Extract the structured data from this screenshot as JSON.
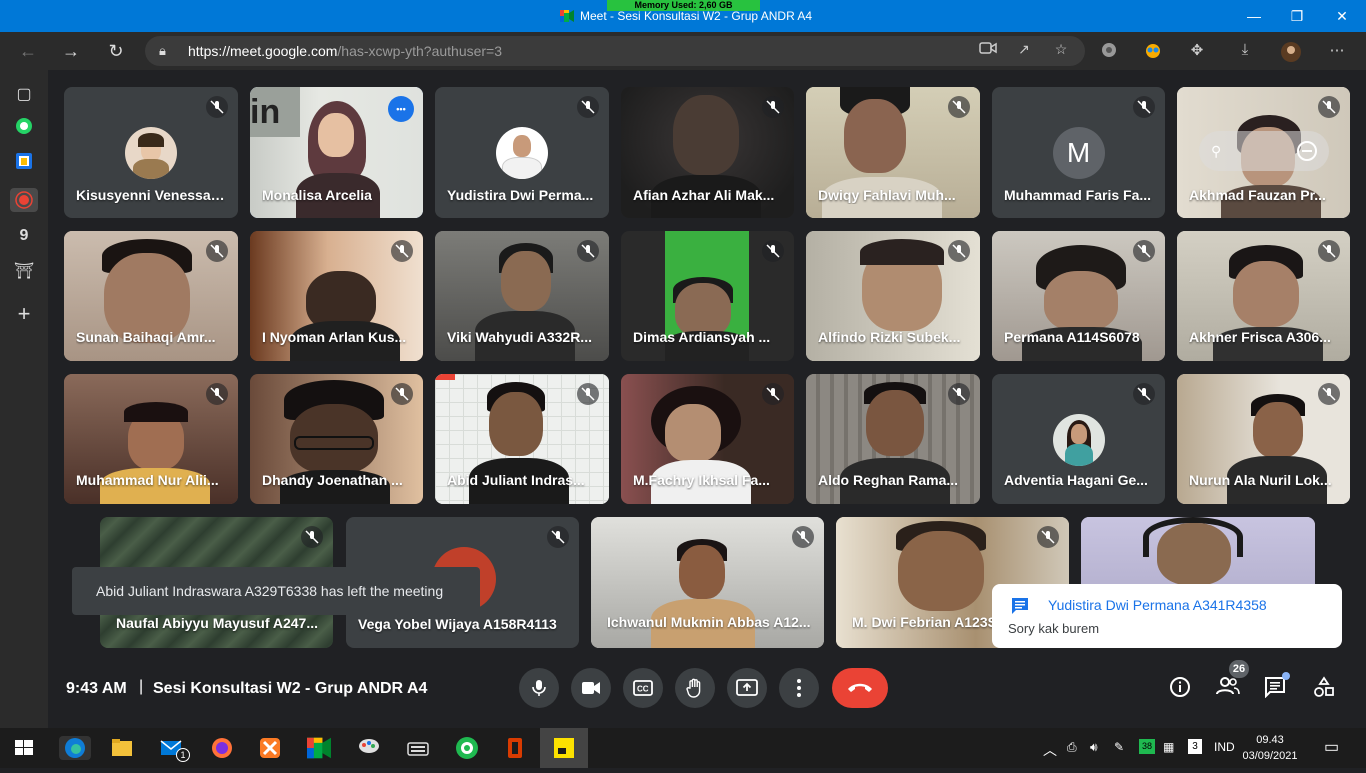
{
  "window": {
    "memory_label": "Memory Used: 2,60 GB",
    "title": "Meet - Sesi Konsultasi W2 - Grup ANDR A4",
    "controls": [
      "—",
      "❐",
      "✕"
    ]
  },
  "browser": {
    "url_main": "https://meet.google.com",
    "url_path": "/has-xcwp-yth?authuser=3"
  },
  "participants_row1": [
    {
      "name": "Kisusyenni Venessa ..."
    },
    {
      "name": "Monalisa Arcelia"
    },
    {
      "name": "Yudistira Dwi Perma..."
    },
    {
      "name": "Afian Azhar Ali Mak..."
    },
    {
      "name": "Dwiqy Fahlavi Muh..."
    },
    {
      "name": "Muhammad Faris Fa...",
      "letter": "M"
    },
    {
      "name": "Akhmad Fauzan Pr..."
    }
  ],
  "participants_row2": [
    {
      "name": "Sunan Baihaqi Amr..."
    },
    {
      "name": "I Nyoman Arlan Kus..."
    },
    {
      "name": "Viki Wahyudi A332R..."
    },
    {
      "name": "Dimas Ardiansyah ..."
    },
    {
      "name": "Alfindo Rizki Subek..."
    },
    {
      "name": "Permana A114S6078"
    },
    {
      "name": "Akhner Frisca A306..."
    }
  ],
  "participants_row3": [
    {
      "name": "Muhammad Nur Alii..."
    },
    {
      "name": "Dhandy Joenathan ..."
    },
    {
      "name": "Abid Juliant Indras..."
    },
    {
      "name": "M.Fachry Ikhsal Fa..."
    },
    {
      "name": "Aldo Reghan Rama..."
    },
    {
      "name": "Adventia Hagani Ge..."
    },
    {
      "name": "Nurun Ala Nuril Lok..."
    }
  ],
  "participants_row4": [
    {
      "name": "Naufal Abiyyu Mayusuf A247..."
    },
    {
      "name": "Vega Yobel Wijaya A158R4113"
    },
    {
      "name": "Ichwanul Mukmin Abbas A12..."
    },
    {
      "name": "M. Dwi Febrian A123S..."
    },
    {
      "name": ""
    }
  ],
  "toast": "Abid Juliant Indraswara A329T6338 has left the meeting",
  "chat_popup": {
    "from": "Yudistira Dwi Permana A341R4358",
    "message": "Sory kak burem"
  },
  "controls": {
    "time": "9:43 AM",
    "separator": "|",
    "meeting_title": "Sesi Konsultasi W2 - Grup ANDR A4",
    "participant_count": "26",
    "more_dots": "•••"
  },
  "taskbar": {
    "clock_time": "09.43",
    "clock_date": "03/09/2021",
    "lang": "IND",
    "tray_badge": "38",
    "mail_badge": "1"
  },
  "colors": {
    "titlebar": "#0078d7",
    "meet_bg": "#202124",
    "end_call": "#ea4335",
    "accent": "#1a73e8"
  }
}
